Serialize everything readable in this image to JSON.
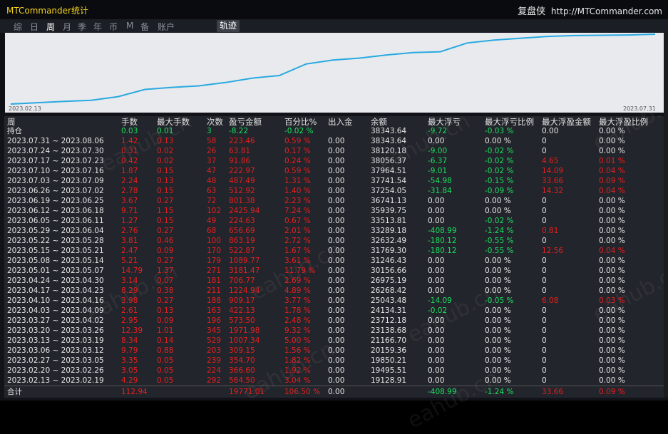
{
  "window": {
    "title": "MTCommander统计",
    "brand_name": "复盘侠",
    "brand_url": "http://MTCommander.com"
  },
  "menu": [
    "综",
    "日",
    "周",
    "月",
    "季",
    "年",
    "币",
    "M",
    "备",
    "账户"
  ],
  "menu_active": "周",
  "menu_button": "轨迹",
  "chart": {
    "x_start": "2023.02.13",
    "x_end": "2023.07.31",
    "line_color": "#29a9e0"
  },
  "chart_data": {
    "type": "line",
    "x": [
      "2023.02.13",
      "2023.02.20",
      "2023.02.27",
      "2023.03.06",
      "2023.03.13",
      "2023.03.20",
      "2023.03.27",
      "2023.04.03",
      "2023.04.10",
      "2023.04.17",
      "2023.04.24",
      "2023.05.01",
      "2023.05.08",
      "2023.05.15",
      "2023.05.22",
      "2023.05.29",
      "2023.06.05",
      "2023.06.12",
      "2023.06.19",
      "2023.06.26",
      "2023.07.03",
      "2023.07.10",
      "2023.07.17",
      "2023.07.24",
      "2023.07.31"
    ],
    "series": [
      {
        "values": [
          19128.91,
          19495.51,
          19850.21,
          20159.36,
          21166.7,
          23138.68,
          23712.18,
          24134.31,
          25043.48,
          26268.42,
          26975.19,
          30156.66,
          31246.43,
          31769.3,
          32632.49,
          33289.18,
          33513.81,
          35939.75,
          36741.13,
          37254.05,
          37741.54,
          37964.51,
          38056.37,
          38120.18,
          38343.64
        ]
      }
    ]
  },
  "table": {
    "headers": [
      "周",
      "手数",
      "最大手数",
      "次数",
      "盈亏金额",
      "百分比%",
      "出入金",
      "余额",
      "最大浮亏",
      "最大浮亏比例",
      "最大浮盈金额",
      "最大浮盈比例"
    ],
    "position_row": {
      "label": "持仓",
      "lots": "0.03",
      "max_lots": "0.01",
      "count": "3",
      "pnl": "-8.22",
      "pct": "-0.02 %",
      "inout": "",
      "balance": "38343.64",
      "max_dd": "-9.72",
      "max_dd_pct": "-0.03 %",
      "max_fp": "0.00",
      "max_fp_pct": "0.00 %"
    },
    "rows": [
      [
        "2023.07.31 ~ 2023.08.06",
        "1.42",
        "0.13",
        "58",
        "223.46",
        "0.59 %",
        "0.00",
        "38343.64",
        "0.00",
        "0.00 %",
        "0",
        "0.00 %"
      ],
      [
        "2023.07.24 ~ 2023.07.30",
        "0.31",
        "0.02",
        "26",
        "63.81",
        "0.17 %",
        "0.00",
        "38120.18",
        "-9.00",
        "-0.02 %",
        "0",
        "0.00 %"
      ],
      [
        "2023.07.17 ~ 2023.07.23",
        "0.42",
        "0.02",
        "37",
        "91.86",
        "0.24 %",
        "0.00",
        "38056.37",
        "-6.37",
        "-0.02 %",
        "4.65",
        "0.01 %"
      ],
      [
        "2023.07.10 ~ 2023.07.16",
        "1.87",
        "0.15",
        "47",
        "222.97",
        "0.59 %",
        "0.00",
        "37964.51",
        "-9.01",
        "-0.02 %",
        "14.09",
        "0.04 %"
      ],
      [
        "2023.07.03 ~ 2023.07.09",
        "2.24",
        "0.13",
        "48",
        "487.49",
        "1.31 %",
        "0.00",
        "37741.54",
        "-54.98",
        "-0.15 %",
        "33.66",
        "0.09 %"
      ],
      [
        "2023.06.26 ~ 2023.07.02",
        "2.78",
        "0.15",
        "63",
        "512.92",
        "1.40 %",
        "0.00",
        "37254.05",
        "-31.84",
        "-0.09 %",
        "14.32",
        "0.04 %"
      ],
      [
        "2023.06.19 ~ 2023.06.25",
        "3.67",
        "0.27",
        "72",
        "801.38",
        "2.23 %",
        "0.00",
        "36741.13",
        "0.00",
        "0.00 %",
        "0",
        "0.00 %"
      ],
      [
        "2023.06.12 ~ 2023.06.18",
        "9.71",
        "1.15",
        "102",
        "2425.94",
        "7.24 %",
        "0.00",
        "35939.75",
        "0.00",
        "0.00 %",
        "0",
        "0.00 %"
      ],
      [
        "2023.06.05 ~ 2023.06.11",
        "1.27",
        "0.15",
        "49",
        "224.63",
        "0.67 %",
        "0.00",
        "33513.81",
        "0.00",
        "-0.02 %",
        "0",
        "0.00 %"
      ],
      [
        "2023.05.29 ~ 2023.06.04",
        "2.76",
        "0.27",
        "68",
        "656.69",
        "2.01 %",
        "0.00",
        "33289.18",
        "-408.99",
        "-1.24 %",
        "0.81",
        "0.00 %"
      ],
      [
        "2023.05.22 ~ 2023.05.28",
        "3.81",
        "0.46",
        "100",
        "863.19",
        "2.72 %",
        "0.00",
        "32632.49",
        "-180.12",
        "-0.55 %",
        "0",
        "0.00 %"
      ],
      [
        "2023.05.15 ~ 2023.05.21",
        "2.47",
        "0.09",
        "170",
        "522.87",
        "1.67 %",
        "0.00",
        "31769.30",
        "-180.12",
        "-0.55 %",
        "12.56",
        "0.04 %"
      ],
      [
        "2023.05.08 ~ 2023.05.14",
        "5.21",
        "0.27",
        "179",
        "1089.77",
        "3.61 %",
        "0.00",
        "31246.43",
        "0.00",
        "0.00 %",
        "0",
        "0.00 %"
      ],
      [
        "2023.05.01 ~ 2023.05.07",
        "14.79",
        "1.37",
        "271",
        "3181.47",
        "11.79 %",
        "0.00",
        "30156.66",
        "0.00",
        "0.00 %",
        "0",
        "0.00 %"
      ],
      [
        "2023.04.24 ~ 2023.04.30",
        "3.14",
        "0.07",
        "181",
        "706.77",
        "2.69 %",
        "0.00",
        "26975.19",
        "0.00",
        "0.00 %",
        "0",
        "0.00 %"
      ],
      [
        "2023.04.17 ~ 2023.04.23",
        "8.29",
        "0.38",
        "211",
        "1224.94",
        "4.89 %",
        "0.00",
        "26268.42",
        "0.00",
        "0.00 %",
        "0",
        "0.00 %"
      ],
      [
        "2023.04.10 ~ 2023.04.16",
        "3.98",
        "0.27",
        "188",
        "909.17",
        "3.77 %",
        "0.00",
        "25043.48",
        "-14.09",
        "-0.05 %",
        "6.08",
        "0.03 %"
      ],
      [
        "2023.04.03 ~ 2023.04.09",
        "2.61",
        "0.13",
        "163",
        "422.13",
        "1.78 %",
        "0.00",
        "24134.31",
        "-0.02",
        "0.00 %",
        "0",
        "0.00 %"
      ],
      [
        "2023.03.27 ~ 2023.04.02",
        "2.95",
        "0.09",
        "196",
        "573.50",
        "2.48 %",
        "0.00",
        "23712.18",
        "0.00",
        "0.00 %",
        "0",
        "0.00 %"
      ],
      [
        "2023.03.20 ~ 2023.03.26",
        "12.39",
        "1.01",
        "345",
        "1971.98",
        "9.32 %",
        "0.00",
        "23138.68",
        "0.00",
        "0.00 %",
        "0",
        "0.00 %"
      ],
      [
        "2023.03.13 ~ 2023.03.19",
        "8.34",
        "0.14",
        "529",
        "1007.34",
        "5.00 %",
        "0.00",
        "21166.70",
        "0.00",
        "0.00 %",
        "0",
        "0.00 %"
      ],
      [
        "2023.03.06 ~ 2023.03.12",
        "9.79",
        "0.88",
        "203",
        "309.15",
        "1.56 %",
        "0.00",
        "20159.36",
        "0.00",
        "0.00 %",
        "0",
        "0.00 %"
      ],
      [
        "2023.02.27 ~ 2023.03.05",
        "3.35",
        "0.05",
        "239",
        "354.70",
        "1.82 %",
        "0.00",
        "19850.21",
        "0.00",
        "0.00 %",
        "0",
        "0.00 %"
      ],
      [
        "2023.02.20 ~ 2023.02.26",
        "3.05",
        "0.05",
        "224",
        "366.60",
        "1.92 %",
        "0.00",
        "19495.51",
        "0.00",
        "0.00 %",
        "0",
        "0.00 %"
      ],
      [
        "2023.02.13 ~ 2023.02.19",
        "4.29",
        "0.05",
        "292",
        "564.50",
        "3.04 %",
        "0.00",
        "19128.91",
        "0.00",
        "0.00 %",
        "0",
        "0.00 %"
      ]
    ],
    "total_row": {
      "label": "合计",
      "lots": "112.94",
      "pnl": "19771.01",
      "pct": "106.50 %",
      "inout": "0.00",
      "max_dd": "-408.99",
      "max_dd_pct": "-1.24 %",
      "max_fp": "33.66",
      "max_fp_pct": "0.09 %"
    }
  },
  "colors": {
    "positive": "#e52020",
    "negative": "#19e060",
    "neutral": "#e6e6e6",
    "title": "#f2d21b",
    "background": "#22252b"
  },
  "watermark": "eahub.cn"
}
